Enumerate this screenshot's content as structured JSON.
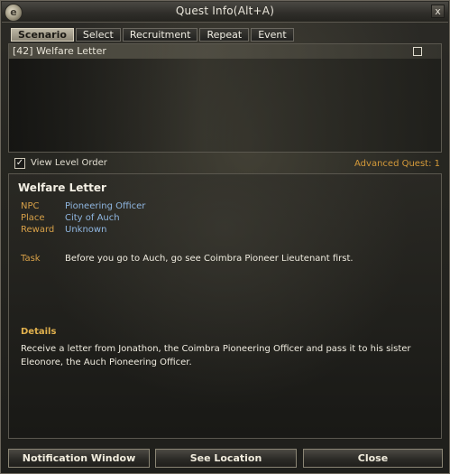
{
  "window": {
    "title": "Quest Info(Alt+A)",
    "close_glyph": "x"
  },
  "tabs": [
    {
      "label": "Scenario",
      "active": true
    },
    {
      "label": "Select",
      "active": false
    },
    {
      "label": "Recruitment",
      "active": false
    },
    {
      "label": "Repeat",
      "active": false
    },
    {
      "label": "Event",
      "active": false
    }
  ],
  "quest_list": {
    "items": [
      {
        "label": "[42] Welfare Letter",
        "checked": false
      }
    ]
  },
  "options": {
    "view_level_order_label": "View Level Order",
    "view_level_order_checked": true,
    "advanced_quest_label": "Advanced Quest: 1"
  },
  "detail": {
    "title": "Welfare Letter",
    "fields": {
      "npc_label": "NPC",
      "npc_value": "Pioneering Officer",
      "place_label": "Place",
      "place_value": "City of Auch",
      "reward_label": "Reward",
      "reward_value": "Unknown",
      "task_label": "Task",
      "task_value": "Before you go to Auch, go see Coimbra Pioneer Lieutenant first."
    },
    "details_heading": "Details",
    "details_text": "Receive a letter from Jonathon, the Coimbra Pioneering Officer and pass it to his sister Eleonore, the Auch Pioneering Officer."
  },
  "buttons": {
    "notification": "Notification Window",
    "see_location": "See Location",
    "close": "Close"
  },
  "colors": {
    "label_orange": "#d7a048",
    "value_blue": "#8fb6e0",
    "advanced_orange": "#d49a3a"
  },
  "icons": {
    "logo": "game-logo-icon",
    "close": "close-icon",
    "check": "checkmark-icon"
  }
}
